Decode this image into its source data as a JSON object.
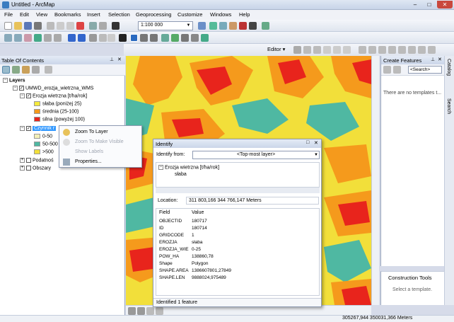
{
  "window": {
    "title": "Untitled - ArcMap",
    "minimize": "–",
    "maximize": "□",
    "close": "✕"
  },
  "menu": [
    "File",
    "Edit",
    "View",
    "Bookmarks",
    "Insert",
    "Selection",
    "Geoprocessing",
    "Customize",
    "Windows",
    "Help"
  ],
  "toolbar": {
    "scale": "1:100 000",
    "editor": "Editor ▾"
  },
  "toc": {
    "title": "Table Of Contents",
    "root": "Layers",
    "service": "UMWD_erozja_wietrzna_WMS",
    "layer1": "Erozja wietrzna [t/ha/rok]",
    "legend1": [
      {
        "label": "słaba (poniżej 25)",
        "color": "#f5ea3b"
      },
      {
        "label": "średnia (25-100)",
        "color": "#f59a1c"
      },
      {
        "label": "silna (powyżej 100)",
        "color": "#e8241c"
      }
    ],
    "layer2": "Czynnik r",
    "legend2": [
      {
        "label": "0-50",
        "color": "#f2efb7"
      },
      {
        "label": "50-500",
        "color": "#4fb8a2"
      },
      {
        "label": ">500",
        "color": "#f2df3a"
      }
    ],
    "layer3": "Podatnoś",
    "layer4": "Obszary"
  },
  "context_menu": {
    "items": [
      {
        "label": "Zoom To Layer",
        "enabled": true
      },
      {
        "label": "Zoom To Make Visible",
        "enabled": false
      },
      {
        "label": "Show Labels",
        "enabled": false
      },
      {
        "label": "Properties...",
        "enabled": true
      }
    ]
  },
  "identify": {
    "title": "Identify",
    "from_label": "Identify from:",
    "from_value": "<Top-most layer>",
    "tree_layer": "Erozja wietrzna [t/ha/rok]",
    "tree_feature": "słaba",
    "location_label": "Location:",
    "location_value": "311 803,166  344 766,147 Meters",
    "col_field": "Field",
    "col_value": "Value",
    "rows": [
      {
        "field": "OBJECTID",
        "value": "180717"
      },
      {
        "field": "ID",
        "value": "180714"
      },
      {
        "field": "GRIDCODE",
        "value": "1"
      },
      {
        "field": "EROZJA",
        "value": "słaba"
      },
      {
        "field": "EROZJA_WIE",
        "value": "0-25"
      },
      {
        "field": "POW_HA",
        "value": "138860,78"
      },
      {
        "field": "Shape",
        "value": "Polygon"
      },
      {
        "field": "SHAPE.AREA",
        "value": "1386607801,27849"
      },
      {
        "field": "SHAPE.LEN",
        "value": "9888024,975489"
      }
    ],
    "status": "Identified 1 feature"
  },
  "create_features": {
    "title": "Create Features",
    "search_placeholder": "<Search>",
    "message": "There are no templates t..."
  },
  "construction_tools": {
    "title": "Construction Tools",
    "message": "Select a template."
  },
  "side_tabs": [
    "Catalog",
    "Search"
  ],
  "status_coords": "305267,944  350031,366 Meters",
  "colors": {
    "yellow": "#f2df3a",
    "orange": "#f59a1c",
    "red": "#e8241c",
    "teal": "#4fb8a2"
  }
}
